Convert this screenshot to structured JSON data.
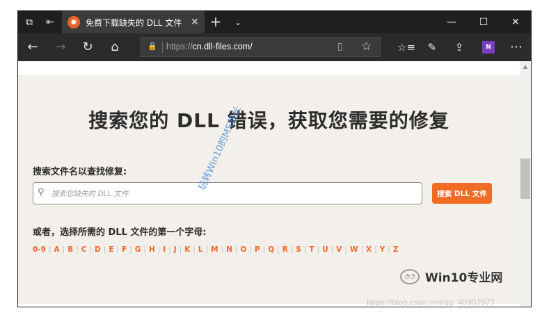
{
  "browser": {
    "tab": {
      "title": "免费下载缺失的 DLL 文件",
      "favicon": "gear-icon",
      "favicon_color": "#e8622a"
    },
    "tab_icons": [
      "tab-preview-icon",
      "set-aside-tabs-icon"
    ],
    "new_tab": "+",
    "tab_menu": "⌄",
    "window_controls": {
      "minimize": "—",
      "maximize": "☐",
      "close": "✕"
    },
    "address": {
      "protocol": "https://",
      "host": "cn.dll-files.com/"
    }
  },
  "page": {
    "heading": "搜索您的 DLL 错误，获取您需要的修复",
    "search_label": "搜索文件名以查找修复:",
    "search_placeholder": "搜索您缺失的 DLL 文件",
    "search_button": "搜索 DLL 文件",
    "alpha_label": "或者，选择所需的 DLL 文件的第一个字母:",
    "letters": [
      "0-9",
      "A",
      "B",
      "C",
      "D",
      "E",
      "F",
      "G",
      "H",
      "I",
      "J",
      "K",
      "L",
      "M",
      "N",
      "O",
      "P",
      "Q",
      "R",
      "S",
      "T",
      "U",
      "V",
      "W",
      "X",
      "Y",
      "Z"
    ],
    "accent_color": "#f06b23"
  },
  "overlay": {
    "watermark": "玩转Win10的MS酋长",
    "wechat_name": "Win10专业网",
    "credit": "https://blog.csdn.net/qq_40907977"
  }
}
